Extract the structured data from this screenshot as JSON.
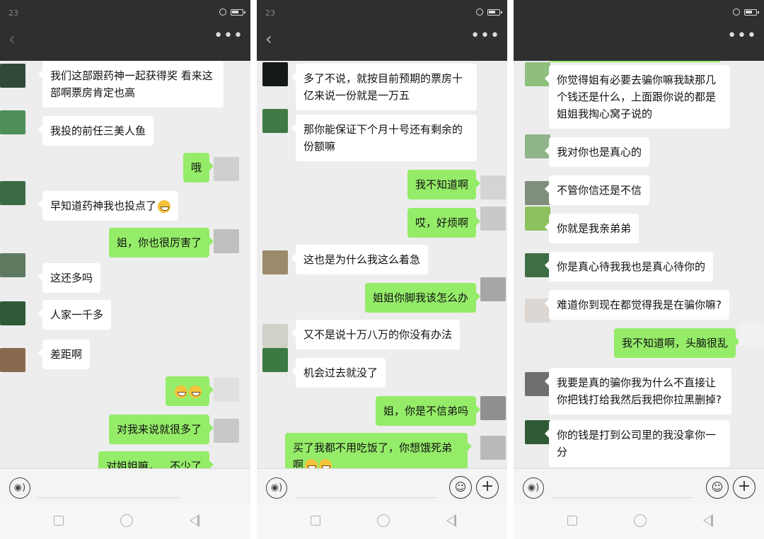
{
  "colors": {
    "header_bg": "#2f2f2f",
    "chat_bg": "#ededed",
    "bubble_incoming": "#ffffff",
    "bubble_outgoing": "#95ec69",
    "nav_bg": "#f7f7f7"
  },
  "status_bar": {
    "time": "23",
    "icons": [
      "alarm-icon",
      "battery-icon"
    ]
  },
  "title_bar": {
    "back_icon": "chevron-left-icon",
    "more_icon": "more-icon",
    "more_glyph": "•••"
  },
  "input_bar": {
    "voice_glyph": "◉)",
    "emoji_glyph": "☺",
    "plus_glyph": "+"
  },
  "panels": [
    {
      "messages": [
        {
          "dir": "in",
          "text": "我们这部跟药神一起获得奖 看来这部啊票房肯定也高"
        },
        {
          "dir": "in",
          "text": "我投的前任三美人鱼"
        },
        {
          "dir": "out",
          "text": "哦"
        },
        {
          "dir": "in",
          "text": "早知道药神我也投点了"
        },
        {
          "dir": "out",
          "text": "姐，你也很厉害了"
        },
        {
          "dir": "in",
          "text": "这还多吗"
        },
        {
          "dir": "in",
          "text": "人家一千多"
        },
        {
          "dir": "in",
          "text": "差距啊"
        },
        {
          "dir": "out",
          "text": ""
        },
        {
          "dir": "out",
          "text": "对我来说就很多了"
        },
        {
          "dir": "out",
          "text": "对姐姐嘛，…不少了"
        }
      ]
    },
    {
      "messages": [
        {
          "dir": "in",
          "text": "多了不说，就按目前预期的票房十亿来说一份就是一万五"
        },
        {
          "dir": "in",
          "text": "那你能保证下个月十号还有剩余的份额嘛"
        },
        {
          "dir": "out",
          "text": "我不知道啊"
        },
        {
          "dir": "out",
          "text": "哎，好烦啊"
        },
        {
          "dir": "in",
          "text": "这也是为什么我这么着急"
        },
        {
          "dir": "out",
          "text": "姐姐你脚我该怎么办"
        },
        {
          "dir": "in",
          "text": "又不是说十万八万的你没有办法"
        },
        {
          "dir": "in",
          "text": "机会过去就没了"
        },
        {
          "dir": "out",
          "text": "姐，你是不信弟吗"
        },
        {
          "dir": "out",
          "text": "买了我都不用吃饭了，你想饿死弟啊"
        }
      ]
    },
    {
      "messages": [
        {
          "dir": "in",
          "text": "你觉得姐有必要去骗你嘛我缺那几个钱还是什么，上面跟你说的都是姐姐我掏心窝子说的"
        },
        {
          "dir": "in",
          "text": "我对你也是真心的"
        },
        {
          "dir": "in",
          "text": "不管你信还是不信"
        },
        {
          "dir": "in",
          "text": "你就是我亲弟弟"
        },
        {
          "dir": "in",
          "text": "你是真心待我我也是真心待你的"
        },
        {
          "dir": "in",
          "text": "难道你到现在都觉得我是在骗你嘛?"
        },
        {
          "dir": "out",
          "text": "我不知道啊，头脑很乱"
        },
        {
          "dir": "in",
          "text": "我要是真的骗你我为什么不直接让你把钱打给我然后我把你拉黑删掉?"
        },
        {
          "dir": "in",
          "text": "你的钱是打到公司里的我没拿你一分"
        }
      ]
    }
  ]
}
